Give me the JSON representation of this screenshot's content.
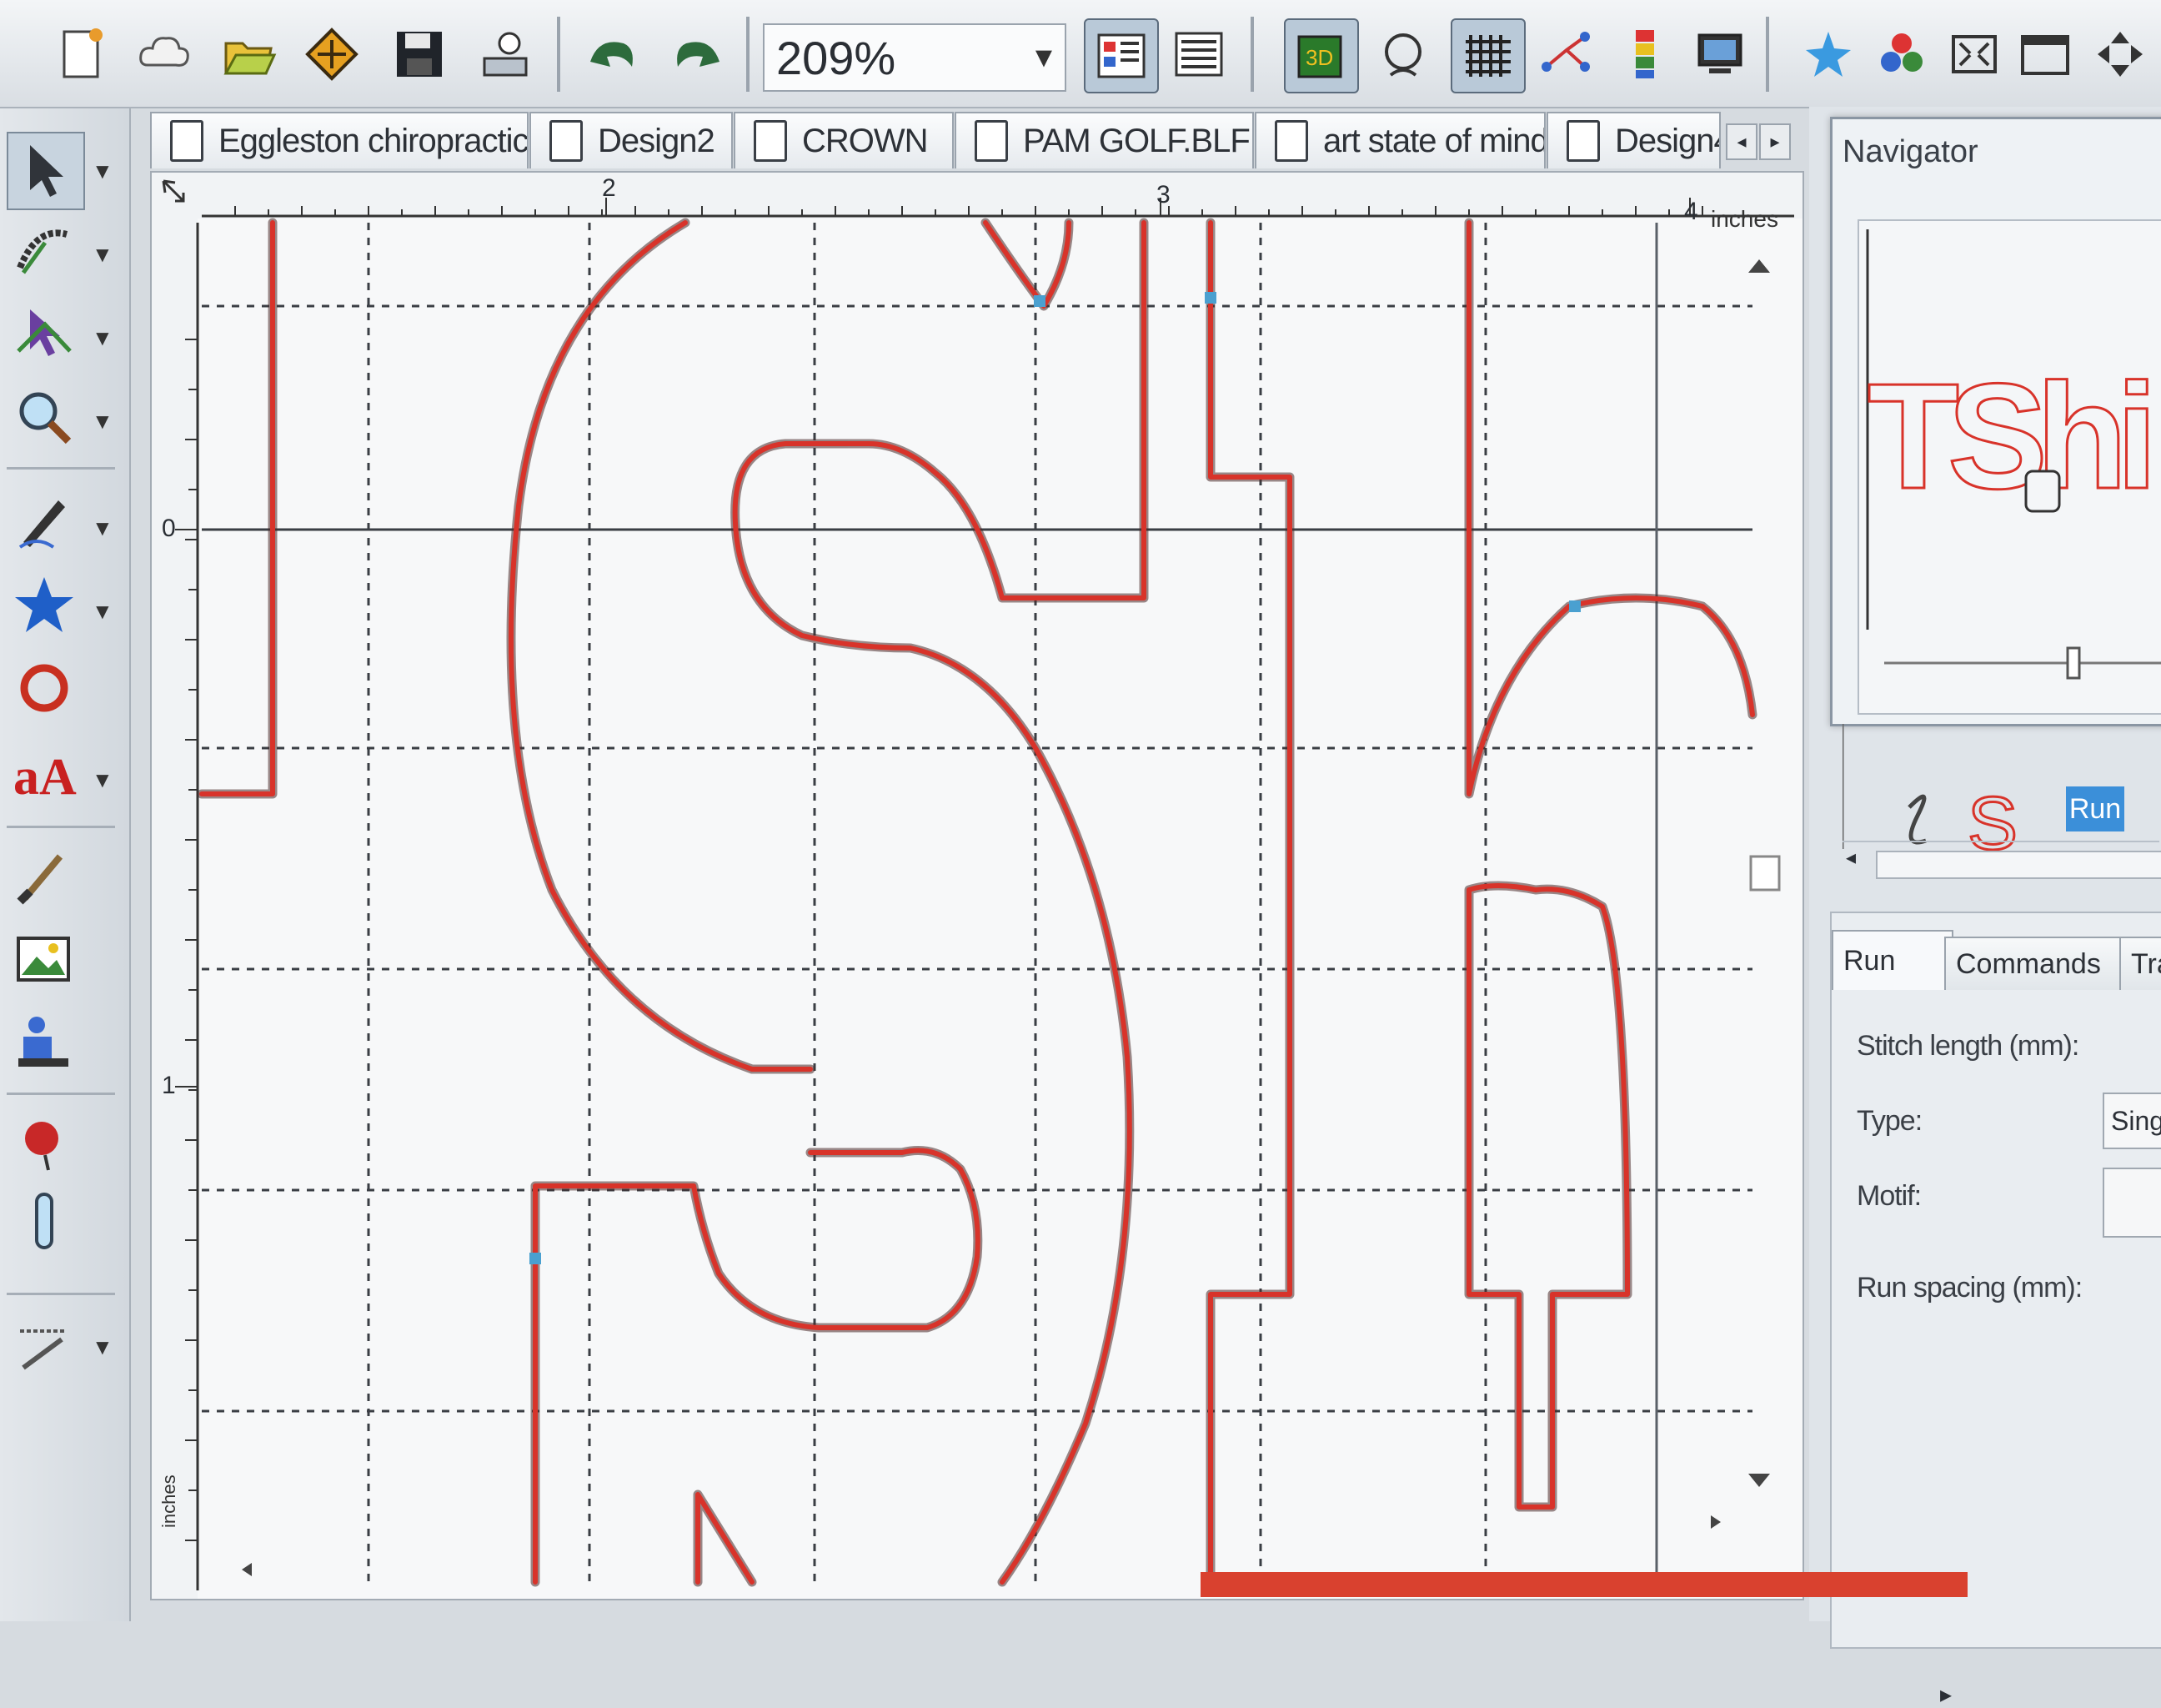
{
  "toolbar": {
    "zoom_value": "209%"
  },
  "tabs": [
    {
      "label": "Eggleston chiropractic",
      "active": false
    },
    {
      "label": "Design2",
      "active": false
    },
    {
      "label": "CROWN",
      "active": false
    },
    {
      "label": "PAM GOLF.BLF",
      "active": false
    },
    {
      "label": "art state of mind",
      "active": false
    },
    {
      "label": "Design4",
      "active": false
    }
  ],
  "ruler": {
    "top_labels": [
      "2",
      "3",
      "4"
    ],
    "left_labels": [
      "0",
      "1"
    ],
    "unit": "inches"
  },
  "navigator": {
    "title": "Navigator",
    "preview_text": "TShi"
  },
  "sequence": {
    "run_label": "Run"
  },
  "properties": {
    "tabs": [
      "Run",
      "Commands",
      "Tran"
    ],
    "stitch_length_label": "Stitch length (mm):",
    "type_label": "Type:",
    "type_value": "Single",
    "motif_label": "Motif:",
    "run_spacing_label": "Run spacing (mm):"
  },
  "colors": {
    "outline": "#d8332a",
    "outline_shadow": "#4a2a2a",
    "accent_blue": "#3b8fd9"
  }
}
